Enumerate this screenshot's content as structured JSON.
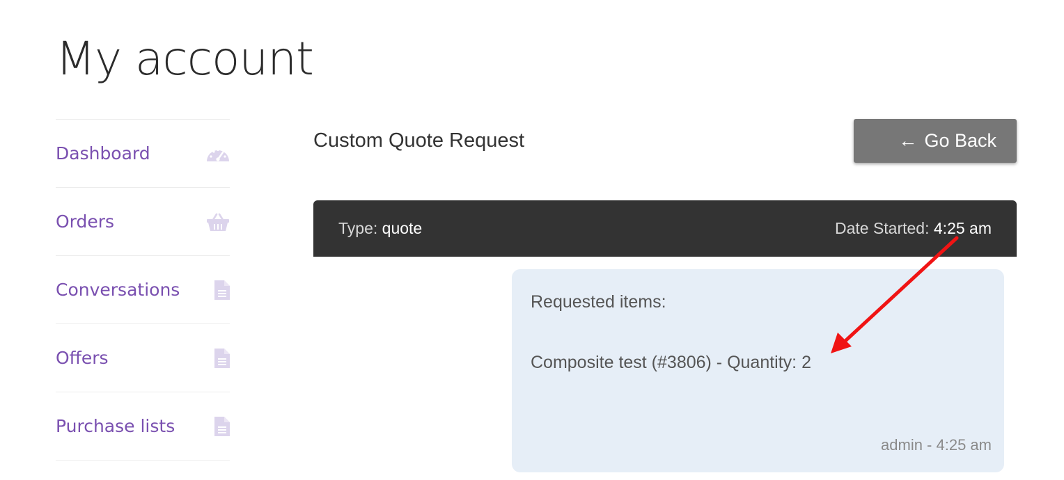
{
  "page": {
    "title": "My account"
  },
  "sidebar": {
    "items": [
      {
        "label": "Dashboard",
        "icon": "dashboard-gauge-icon"
      },
      {
        "label": "Orders",
        "icon": "basket-icon"
      },
      {
        "label": "Conversations",
        "icon": "document-icon"
      },
      {
        "label": "Offers",
        "icon": "document-icon"
      },
      {
        "label": "Purchase lists",
        "icon": "document-icon"
      }
    ],
    "link_color": "#7a50b0",
    "icon_color": "#dcd4ec"
  },
  "conversation": {
    "title": "Custom Quote Request",
    "back_button": {
      "arrow": "←",
      "label": "Go Back"
    },
    "header": {
      "type_label": "Type:",
      "type_value": "quote",
      "date_label": "Date Started:",
      "date_value": "4:25 am"
    },
    "message": {
      "title": "Requested items:",
      "item": "Composite test (#3806) - Quantity: 2",
      "author": "admin",
      "separator": " - ",
      "time": "4:25 am"
    }
  },
  "annotation": {
    "type": "red-arrow",
    "color": "#f01414"
  }
}
